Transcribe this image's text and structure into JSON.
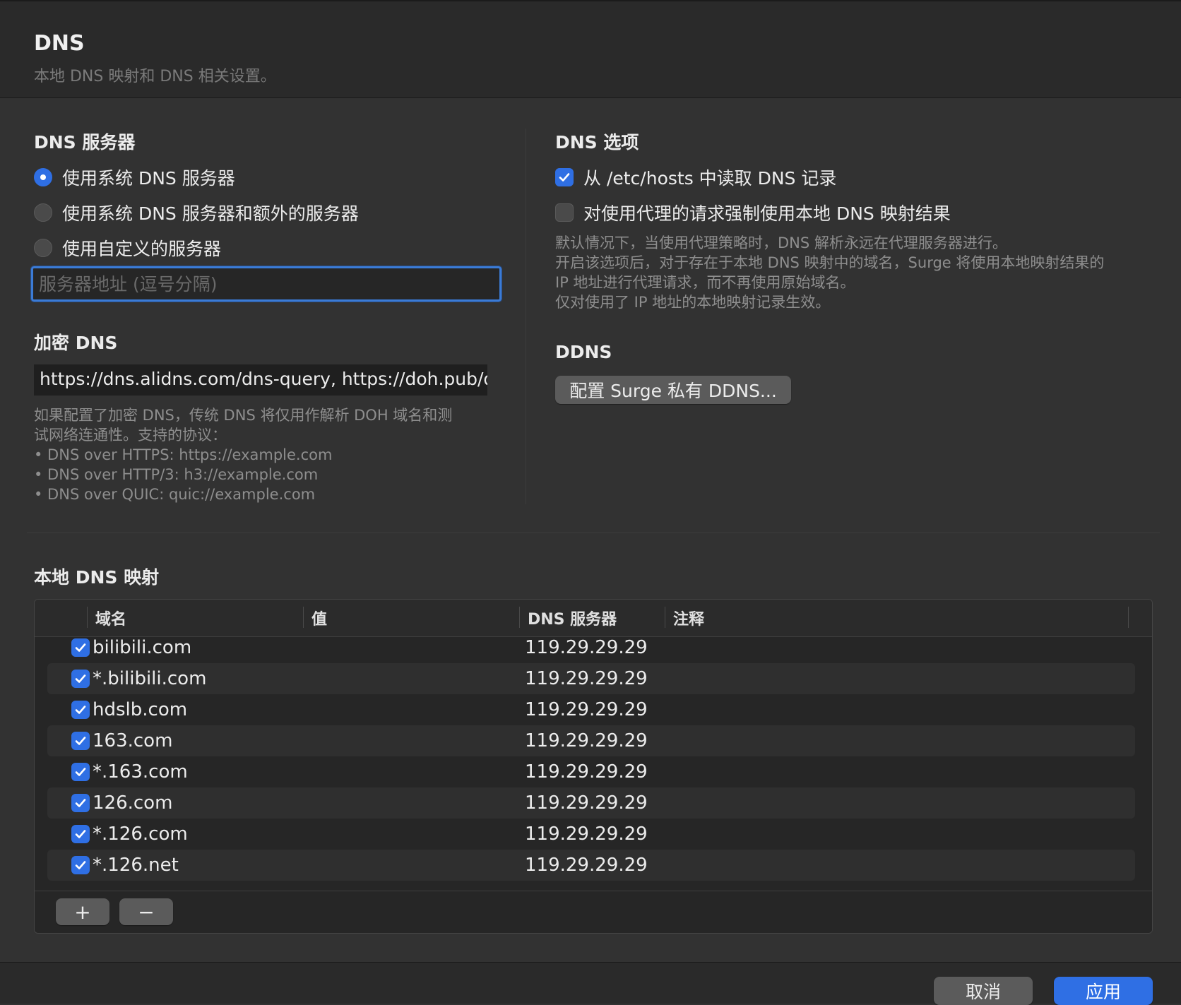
{
  "header": {
    "title": "DNS",
    "subtitle": "本地 DNS 映射和 DNS 相关设置。"
  },
  "dns_servers": {
    "title": "DNS 服务器",
    "options": [
      {
        "label": "使用系统 DNS 服务器",
        "selected": true
      },
      {
        "label": "使用系统 DNS 服务器和额外的服务器",
        "selected": false
      },
      {
        "label": "使用自定义的服务器",
        "selected": false
      }
    ],
    "input_placeholder": "服务器地址 (逗号分隔)",
    "input_value": ""
  },
  "encrypted_dns": {
    "title": "加密 DNS",
    "value": "https://dns.alidns.com/dns-query, https://doh.pub/dns-query",
    "help": [
      "如果配置了加密 DNS，传统 DNS 将仅用作解析 DOH 域名和测",
      "试网络连通性。支持的协议：",
      "• DNS over HTTPS: https://example.com",
      "• DNS over HTTP/3: h3://example.com",
      "• DNS over QUIC: quic://example.com"
    ]
  },
  "dns_options": {
    "title": "DNS 选项",
    "read_hosts": {
      "label": "从 /etc/hosts 中读取 DNS 记录",
      "checked": true
    },
    "force_local": {
      "label": "对使用代理的请求强制使用本地 DNS 映射结果",
      "checked": false
    },
    "help": [
      "默认情况下，当使用代理策略时，DNS 解析永远在代理服务器进行。",
      "开启该选项后，对于存在于本地 DNS 映射中的域名，Surge 将使用本地映射结果的",
      "IP 地址进行代理请求，而不再使用原始域名。",
      "仅对使用了 IP 地址的本地映射记录生效。"
    ]
  },
  "ddns": {
    "title": "DDNS",
    "button_label": "配置 Surge 私有 DDNS..."
  },
  "local_mapping": {
    "title": "本地 DNS 映射",
    "columns": [
      "域名",
      "值",
      "DNS 服务器",
      "注释"
    ],
    "rows": [
      {
        "enabled": true,
        "domain": "bilibili.com",
        "value": "",
        "dns_server": "119.29.29.29",
        "comment": ""
      },
      {
        "enabled": true,
        "domain": "*.bilibili.com",
        "value": "",
        "dns_server": "119.29.29.29",
        "comment": ""
      },
      {
        "enabled": true,
        "domain": "hdslb.com",
        "value": "",
        "dns_server": "119.29.29.29",
        "comment": ""
      },
      {
        "enabled": true,
        "domain": "163.com",
        "value": "",
        "dns_server": "119.29.29.29",
        "comment": ""
      },
      {
        "enabled": true,
        "domain": "*.163.com",
        "value": "",
        "dns_server": "119.29.29.29",
        "comment": ""
      },
      {
        "enabled": true,
        "domain": "126.com",
        "value": "",
        "dns_server": "119.29.29.29",
        "comment": ""
      },
      {
        "enabled": true,
        "domain": "*.126.com",
        "value": "",
        "dns_server": "119.29.29.29",
        "comment": ""
      },
      {
        "enabled": true,
        "domain": "*.126.net",
        "value": "",
        "dns_server": "119.29.29.29",
        "comment": ""
      }
    ],
    "add_label": "+",
    "remove_label": "−"
  },
  "footer": {
    "cancel_label": "取消",
    "apply_label": "应用"
  },
  "colors": {
    "accent": "#2f6fe4",
    "background": "#323232",
    "header_bg": "#2a2a2a"
  }
}
